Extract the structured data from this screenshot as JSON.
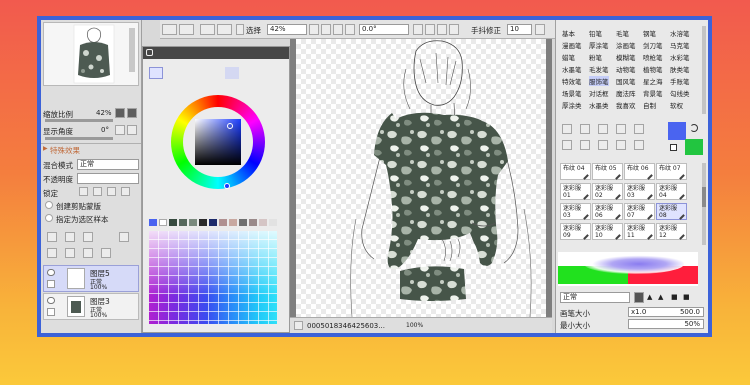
{
  "toolbar": {
    "select_label": "选择",
    "zoom_value": "42%",
    "angle_value": "0.0°",
    "stabilizer_label": "手抖修正",
    "stabilizer_value": "10"
  },
  "left_panel": {
    "zoom_label": "缩放比例",
    "zoom_value": "42%",
    "angle_label": "显示角度",
    "angle_value": "0°",
    "effects_label": "特殊效果",
    "blend_label": "混合模式",
    "blend_value": "正常",
    "opacity_label": "不透明度",
    "lock_label": "锁定",
    "clip_label": "创建剪贴蒙版",
    "ref_label": "指定为选区样本",
    "layers": [
      {
        "name": "图层5",
        "mode": "正常",
        "opacity": "100%"
      },
      {
        "name": "图层3",
        "mode": "正常",
        "opacity": "100%"
      }
    ]
  },
  "status_bar": {
    "filename": "0005018346425603...",
    "zoom": "100%"
  },
  "brush_categories": [
    [
      "基本",
      "铅笔",
      "毛笔",
      "钢笔",
      "水溶笔"
    ],
    [
      "漫画笔",
      "厚涂笔",
      "涂画笔",
      "剑刀笔",
      "马克笔"
    ],
    [
      "蜡笔",
      "粉笔",
      "模糊笔",
      "喷枪笔",
      "水彩笔"
    ],
    [
      "水墨笔",
      "毛发笔",
      "动物笔",
      "植物笔",
      "肤类笔"
    ],
    [
      "特效笔",
      "服饰笔",
      "国风笔",
      "星之海",
      "手账笔"
    ],
    [
      "场景笔",
      "对话框",
      "魔法阵",
      "背景笔",
      "勾线类"
    ],
    [
      "厚涂类",
      "水墨类",
      "我喜欢",
      "自制",
      "软权"
    ]
  ],
  "brush_cells": [
    [
      "布纹 04",
      "布纹 05",
      "布纹 06",
      "布纹 07"
    ],
    [
      "迷彩服 01",
      "迷彩服 02",
      "迷彩服 03",
      "迷彩服 04"
    ],
    [
      "迷彩服 03",
      "迷彩服 06",
      "迷彩服 07",
      "迷彩服 08"
    ],
    [
      "迷彩服 09",
      "迷彩服 10",
      "迷彩服 11",
      "迷彩服 12"
    ]
  ],
  "brush_settings": {
    "blend_value": "正常",
    "size_label": "画笔大小",
    "size_mult": "x1.0",
    "size_value": "500.0",
    "min_size_label": "最小大小",
    "min_size_value": "50%"
  },
  "colors": {
    "frame": "#3c62d8",
    "primary_color": "#4a64f0",
    "secondary_color": "#22c540",
    "selected_tab": "#c5cdf7"
  },
  "icons": [
    "palette-icon",
    "pencil-icon",
    "eye-icon",
    "lock-icon",
    "trash-icon",
    "rotate-icon",
    "swap-icon",
    "brush-icon",
    "eraser-icon",
    "eyedropper-icon"
  ]
}
